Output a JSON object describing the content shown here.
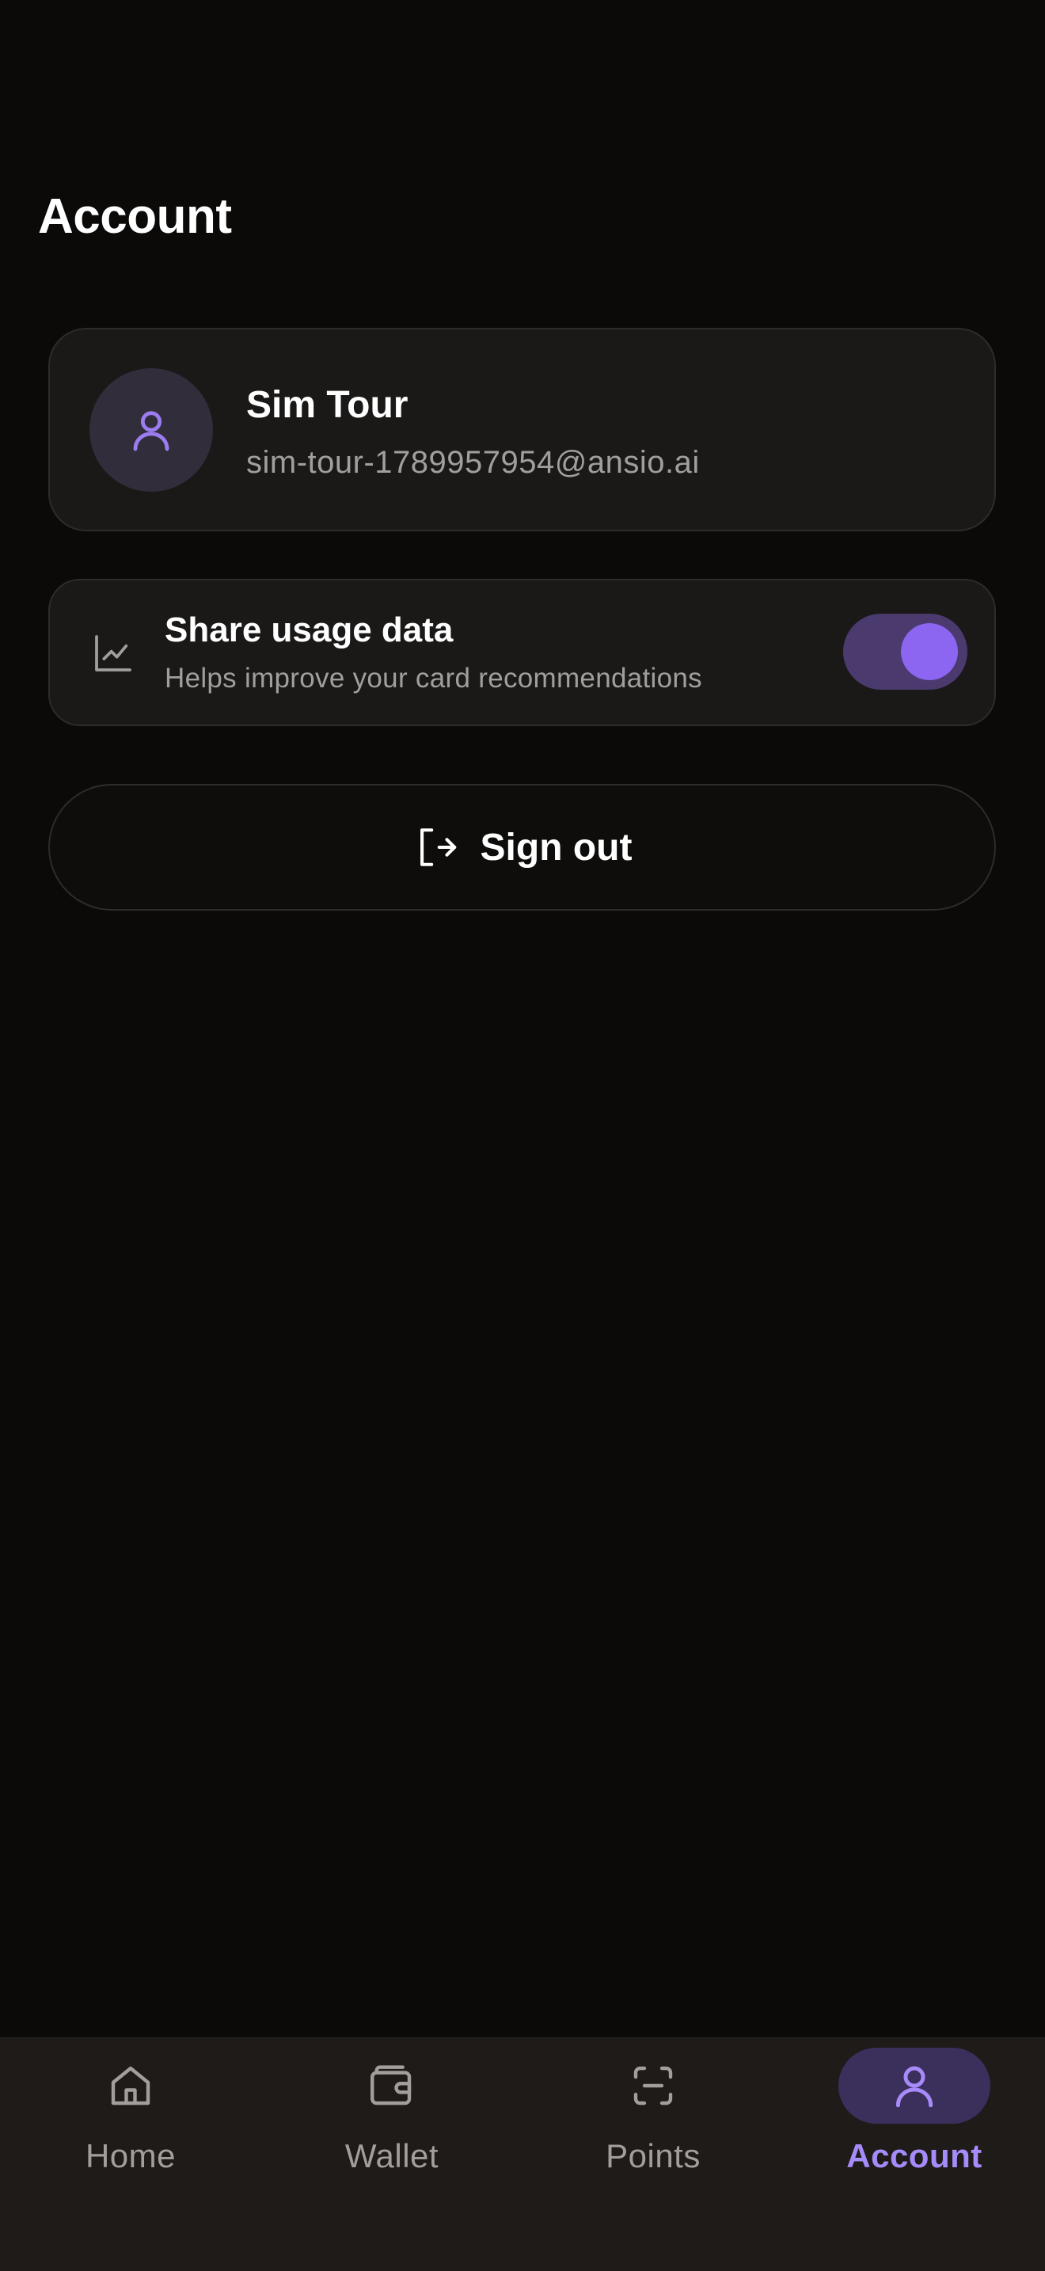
{
  "header": {
    "title": "Account"
  },
  "profile": {
    "name": "Sim Tour",
    "email": "sim-tour-1789957954@ansio.ai",
    "avatar_icon": "user-icon"
  },
  "share_usage": {
    "icon": "chart-line-icon",
    "title": "Share usage data",
    "subtitle": "Helps improve your card recommendations",
    "enabled": true
  },
  "sign_out": {
    "icon": "sign-out-icon",
    "label": "Sign out"
  },
  "tab_bar": {
    "tabs": [
      {
        "label": "Home",
        "icon": "home-icon",
        "active": false
      },
      {
        "label": "Wallet",
        "icon": "wallet-icon",
        "active": false
      },
      {
        "label": "Points",
        "icon": "scan-icon",
        "active": false
      },
      {
        "label": "Account",
        "icon": "user-icon",
        "active": true
      }
    ]
  },
  "colors": {
    "background": "#0b0a09",
    "card": "#1b1918",
    "accent": "#a78bfa",
    "toggle_on": "#8c66f0",
    "muted_text": "#a29e9b"
  }
}
